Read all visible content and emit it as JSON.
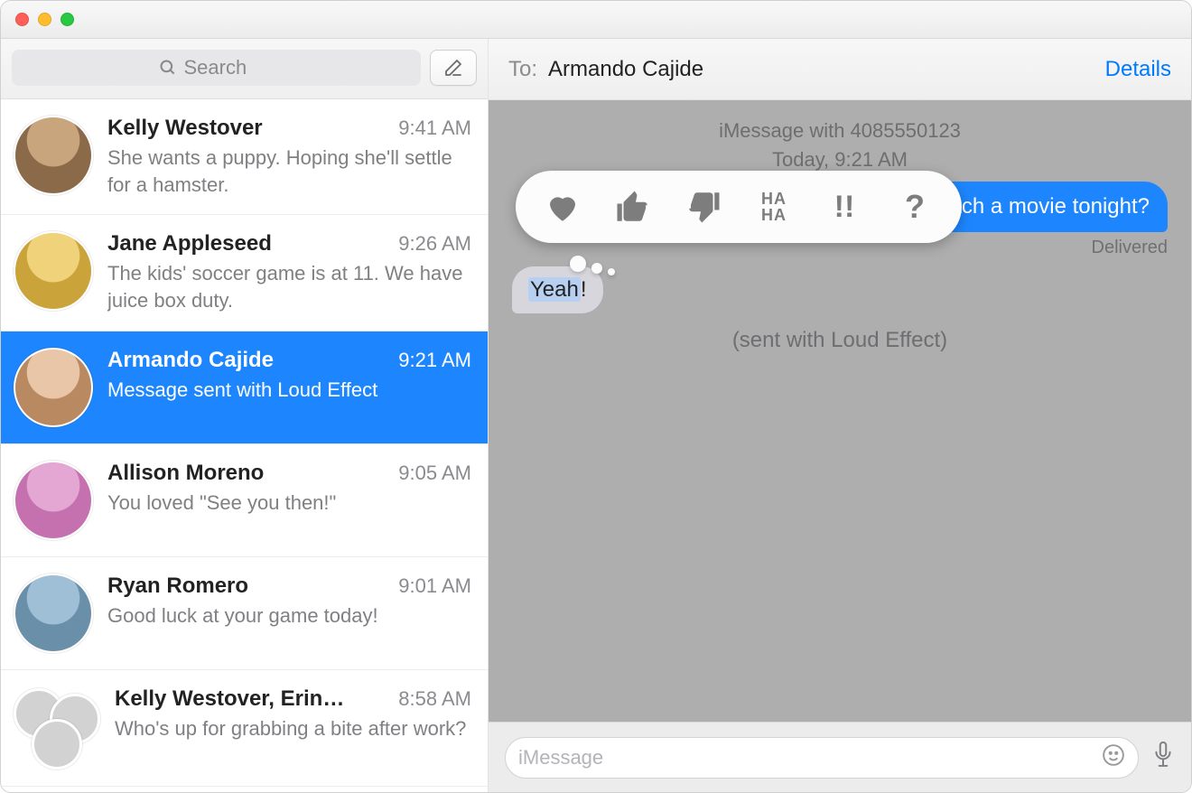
{
  "search": {
    "placeholder": "Search"
  },
  "conversations": [
    {
      "name": "Kelly Westover",
      "time": "9:41 AM",
      "preview": "She wants a puppy. Hoping she'll settle for a hamster.",
      "selected": false,
      "avatar": "g0"
    },
    {
      "name": "Jane Appleseed",
      "time": "9:26 AM",
      "preview": "The kids' soccer game is at 11. We have juice box duty.",
      "selected": false,
      "avatar": "g1"
    },
    {
      "name": "Armando Cajide",
      "time": "9:21 AM",
      "preview": "Message sent with Loud Effect",
      "selected": true,
      "avatar": "g2"
    },
    {
      "name": "Allison Moreno",
      "time": "9:05 AM",
      "preview": "You loved \"See you then!\"",
      "selected": false,
      "avatar": "g3"
    },
    {
      "name": "Ryan Romero",
      "time": "9:01 AM",
      "preview": "Good luck at your game today!",
      "selected": false,
      "avatar": "g4"
    },
    {
      "name": "Kelly Westover, Erin…",
      "time": "8:58 AM",
      "preview": "Who's up for grabbing a bite after work?",
      "selected": false,
      "group": true
    }
  ],
  "header": {
    "to": "To:",
    "recipient": "Armando Cajide",
    "details": "Details"
  },
  "thread": {
    "meta_line1": "iMessage with 4085550123",
    "meta_line2": "Today, 9:21 AM",
    "outgoing": "Wanna go catch a movie tonight?",
    "delivered": "Delivered",
    "incoming_hi": "Yeah",
    "incoming_tail": "!",
    "effect": "(sent with Loud Effect)"
  },
  "tapback": {
    "heart": "heart",
    "thumbs_up": "thumbs-up",
    "thumbs_down": "thumbs-down",
    "haha": "HA HA",
    "exclaim": "!!",
    "question": "?"
  },
  "composer": {
    "placeholder": "iMessage"
  }
}
